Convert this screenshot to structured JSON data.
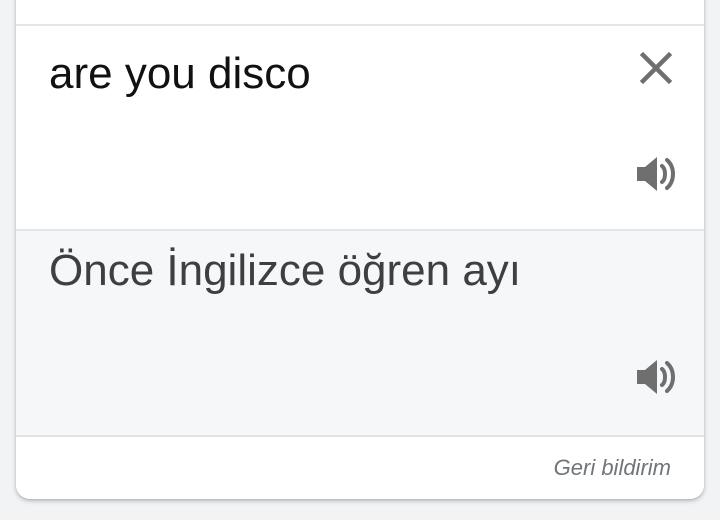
{
  "translation_card": {
    "source": {
      "text": "are you disco",
      "clear_icon": "close-icon",
      "speaker_icon": "volume-icon"
    },
    "target": {
      "text": "Önce İngilizce öğren ayı",
      "speaker_icon": "volume-icon"
    },
    "footer": {
      "feedback_label": "Geri bildirim"
    }
  },
  "colors": {
    "page_background": "#f1f3f4",
    "card_background": "#ffffff",
    "target_background": "#f5f7f9",
    "source_text": "#111111",
    "target_text": "#3c4043",
    "icon": "#6f6f6f",
    "divider": "#e3e5e8"
  }
}
